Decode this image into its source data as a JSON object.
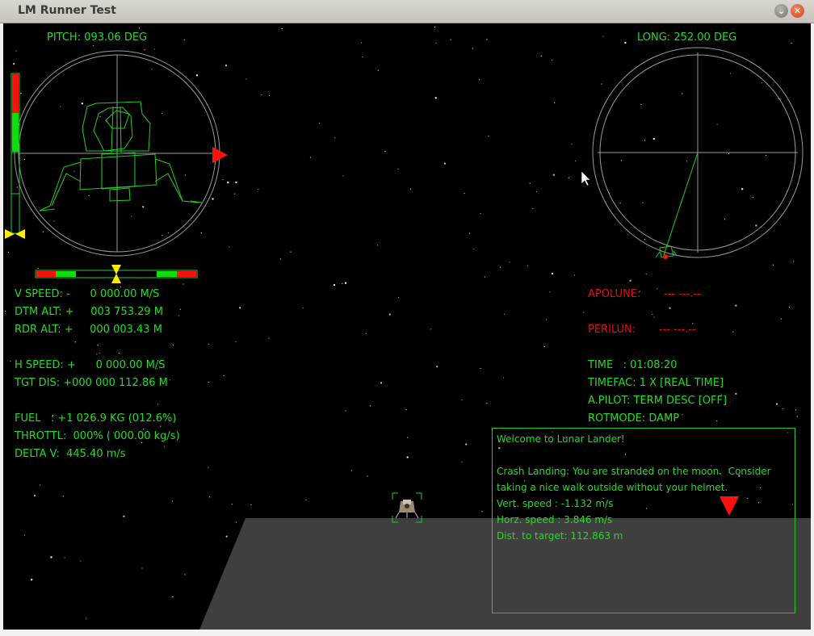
{
  "window": {
    "title": "LM Runner Test"
  },
  "attitude": {
    "pitch_label": "PITCH: 093.06 DEG",
    "long_label": "LONG: 252.00 DEG"
  },
  "telemetry_left": {
    "v_speed": "V SPEED: -      0 000.00 M/S",
    "dtm_alt": "DTM ALT: +     003 753.29 M",
    "rdr_alt": "RDR ALT: +     000 003.43 M",
    "h_speed": "H SPEED: +      0 000.00 M/S",
    "tgt_dis": "TGT DIS: +000 000 112.86 M",
    "fuel": "FUEL   : +1 026.9 KG (012.6%)",
    "throttle": "THROTTL:  000% ( 000.00 kg/s)",
    "delta_v": "DELTA V:  445.40 m/s"
  },
  "telemetry_right": {
    "apolune_label": "APOLUNE:",
    "apolune_value": "--- ---.--",
    "perilun_label": "PERILUN:",
    "perilun_value": "--- ---.--",
    "time": "TIME   : 01:08:20",
    "timefac": "TIMEFAC: 1 X [REAL TIME]",
    "apilot": "A.PILOT: TERM DESC [OFF]",
    "rotmode": "ROTMODE: DAMP"
  },
  "messages": {
    "welcome": "Welcome to Lunar Lander!",
    "crash_line1": "Crash Landing: You are stranded on the moon.  Consider",
    "crash_line2": "taking a nice walk outside without your helmet.",
    "vert_speed": "Vert. speed : -1.132 m/s",
    "horz_speed": "Horz. speed : 3.846 m/s",
    "dist_target": "Dist. to target: 112.863 m"
  },
  "colors": {
    "hud_green": "#22dd22",
    "hud_red": "#e01010",
    "marker_yellow": "#ffee00",
    "ground": "#3f3f3f",
    "gauge_ring": "#aaaaaa"
  }
}
